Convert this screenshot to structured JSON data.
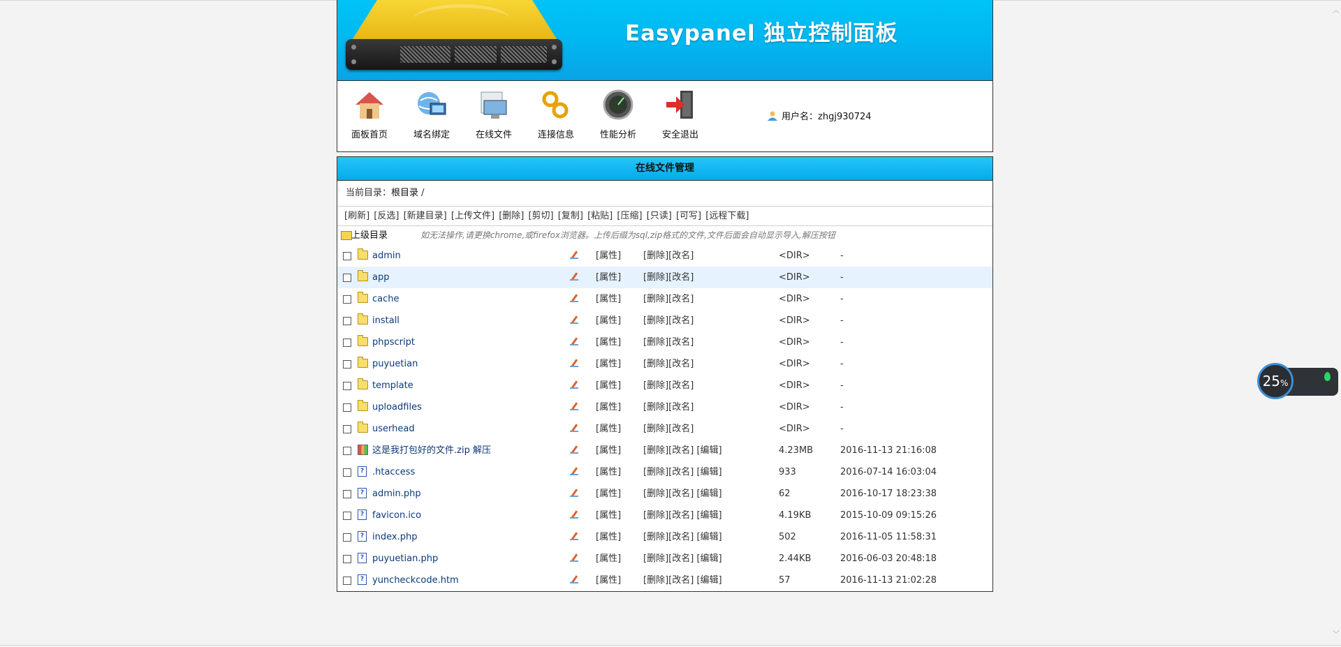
{
  "banner": {
    "title": "Easypanel 独立控制面板"
  },
  "nav": {
    "items": [
      {
        "label": "面板首页"
      },
      {
        "label": "域名绑定"
      },
      {
        "label": "在线文件"
      },
      {
        "label": "连接信息"
      },
      {
        "label": "性能分析"
      },
      {
        "label": "安全退出"
      }
    ],
    "user": {
      "label": "用户名：",
      "name": "zhgj930724"
    }
  },
  "panel": {
    "title": "在线文件管理",
    "current_dir_label": "当前目录：",
    "current_dir": "根目录",
    "current_dir_sep": "/",
    "toolbar": [
      "[刷新]",
      "[反选]",
      "[新建目录]",
      "[上传文件]",
      "[删除]",
      "[剪切]",
      "[复制]",
      "[粘贴]",
      "[压缩]",
      "[只读]",
      "[可写]",
      "[远程下载]"
    ],
    "parent_dir": "上级目录",
    "note": "如无法操作,请更换chrome,或firefox浏览器。上传后缀为sql,zip格式的文件,文件后面会自动显示导入,解压按钮",
    "attr_label": "[属性]",
    "delete_label": "[删除]",
    "rename_label": "[改名]",
    "edit_label": "[编辑]",
    "files": [
      {
        "name": "admin",
        "type": "dir",
        "size": "<DIR>",
        "time": "-"
      },
      {
        "name": "app",
        "type": "dir",
        "size": "<DIR>",
        "time": "-"
      },
      {
        "name": "cache",
        "type": "dir",
        "size": "<DIR>",
        "time": "-"
      },
      {
        "name": "install",
        "type": "dir",
        "size": "<DIR>",
        "time": "-"
      },
      {
        "name": "phpscript",
        "type": "dir",
        "size": "<DIR>",
        "time": "-"
      },
      {
        "name": "puyuetian",
        "type": "dir",
        "size": "<DIR>",
        "time": "-"
      },
      {
        "name": "template",
        "type": "dir",
        "size": "<DIR>",
        "time": "-"
      },
      {
        "name": "uploadfiles",
        "type": "dir",
        "size": "<DIR>",
        "time": "-"
      },
      {
        "name": "userhead",
        "type": "dir",
        "size": "<DIR>",
        "time": "-"
      },
      {
        "name": "这是我打包好的文件.zip 解压",
        "type": "zip",
        "size": "4.23MB",
        "time": "2016-11-13 21:16:08"
      },
      {
        "name": ".htaccess",
        "type": "file",
        "size": "933",
        "time": "2016-07-14 16:03:04"
      },
      {
        "name": "admin.php",
        "type": "file",
        "size": "62",
        "time": "2016-10-17 18:23:38"
      },
      {
        "name": "favicon.ico",
        "type": "file",
        "size": "4.19KB",
        "time": "2015-10-09 09:15:26"
      },
      {
        "name": "index.php",
        "type": "file",
        "size": "502",
        "time": "2016-11-05 11:58:31"
      },
      {
        "name": "puyuetian.php",
        "type": "file",
        "size": "2.44KB",
        "time": "2016-06-03 20:48:18"
      },
      {
        "name": "yuncheckcode.htm",
        "type": "file",
        "size": "57",
        "time": "2016-11-13 21:02:28"
      }
    ],
    "highlighted_row": 1
  },
  "widget": {
    "value": "25",
    "unit": "%"
  }
}
